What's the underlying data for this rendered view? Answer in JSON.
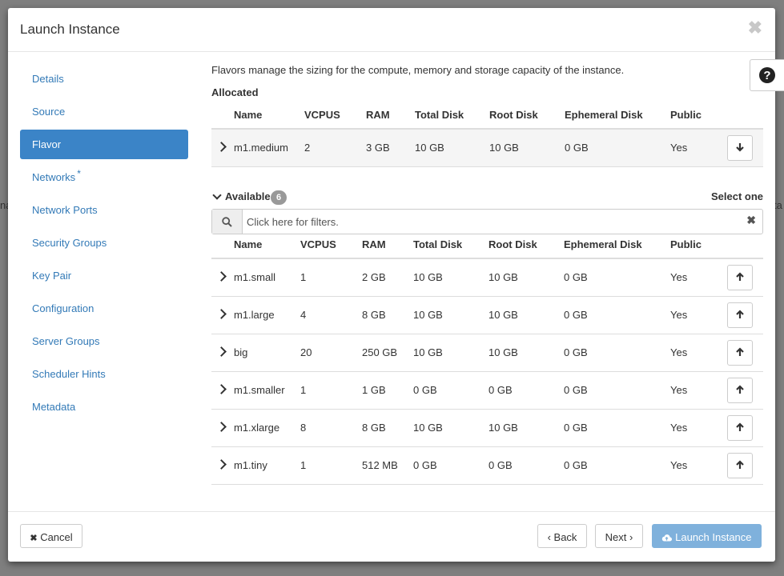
{
  "background": {
    "left_fragment": "na",
    "right_fragment": "ta"
  },
  "modal": {
    "title": "Launch Instance",
    "close_glyph": "✖"
  },
  "nav": {
    "items": [
      {
        "label": "Details",
        "active": false
      },
      {
        "label": "Source",
        "active": false
      },
      {
        "label": "Flavor",
        "active": true
      },
      {
        "label": "Networks",
        "active": false,
        "required": "*"
      },
      {
        "label": "Network Ports",
        "active": false
      },
      {
        "label": "Security Groups",
        "active": false
      },
      {
        "label": "Key Pair",
        "active": false
      },
      {
        "label": "Configuration",
        "active": false
      },
      {
        "label": "Server Groups",
        "active": false
      },
      {
        "label": "Scheduler Hints",
        "active": false
      },
      {
        "label": "Metadata",
        "active": false
      }
    ]
  },
  "help": {
    "glyph": "?"
  },
  "flavor": {
    "description": "Flavors manage the sizing for the compute, memory and storage capacity of the instance.",
    "allocated_title": "Allocated",
    "columns": [
      "Name",
      "VCPUS",
      "RAM",
      "Total Disk",
      "Root Disk",
      "Ephemeral Disk",
      "Public"
    ],
    "allocated": [
      {
        "name": "m1.medium",
        "vcpus": "2",
        "ram": "3 GB",
        "total_disk": "10 GB",
        "root_disk": "10 GB",
        "ephemeral_disk": "0 GB",
        "public": "Yes"
      }
    ],
    "available_title": "Available",
    "available_count": "6",
    "select_one": "Select one",
    "filter_placeholder": "Click here for filters.",
    "available": [
      {
        "name": "m1.small",
        "vcpus": "1",
        "ram": "2 GB",
        "total_disk": "10 GB",
        "root_disk": "10 GB",
        "ephemeral_disk": "0 GB",
        "public": "Yes"
      },
      {
        "name": "m1.large",
        "vcpus": "4",
        "ram": "8 GB",
        "total_disk": "10 GB",
        "root_disk": "10 GB",
        "ephemeral_disk": "0 GB",
        "public": "Yes"
      },
      {
        "name": "big",
        "vcpus": "20",
        "ram": "250 GB",
        "total_disk": "10 GB",
        "root_disk": "10 GB",
        "ephemeral_disk": "0 GB",
        "public": "Yes"
      },
      {
        "name": "m1.smaller",
        "vcpus": "1",
        "ram": "1 GB",
        "total_disk": "0 GB",
        "root_disk": "0 GB",
        "ephemeral_disk": "0 GB",
        "public": "Yes"
      },
      {
        "name": "m1.xlarge",
        "vcpus": "8",
        "ram": "8 GB",
        "total_disk": "10 GB",
        "root_disk": "10 GB",
        "ephemeral_disk": "0 GB",
        "public": "Yes"
      },
      {
        "name": "m1.tiny",
        "vcpus": "1",
        "ram": "512 MB",
        "total_disk": "0 GB",
        "root_disk": "0 GB",
        "ephemeral_disk": "0 GB",
        "public": "Yes"
      }
    ]
  },
  "footer": {
    "cancel_label": "Cancel",
    "back_label": "‹ Back",
    "next_label": "Next ›",
    "launch_label": "Launch Instance"
  },
  "colors": {
    "link": "#337ab7",
    "active_nav": "#3b84c7",
    "launch_button": "#7fb1dc",
    "badge": "#999999"
  }
}
